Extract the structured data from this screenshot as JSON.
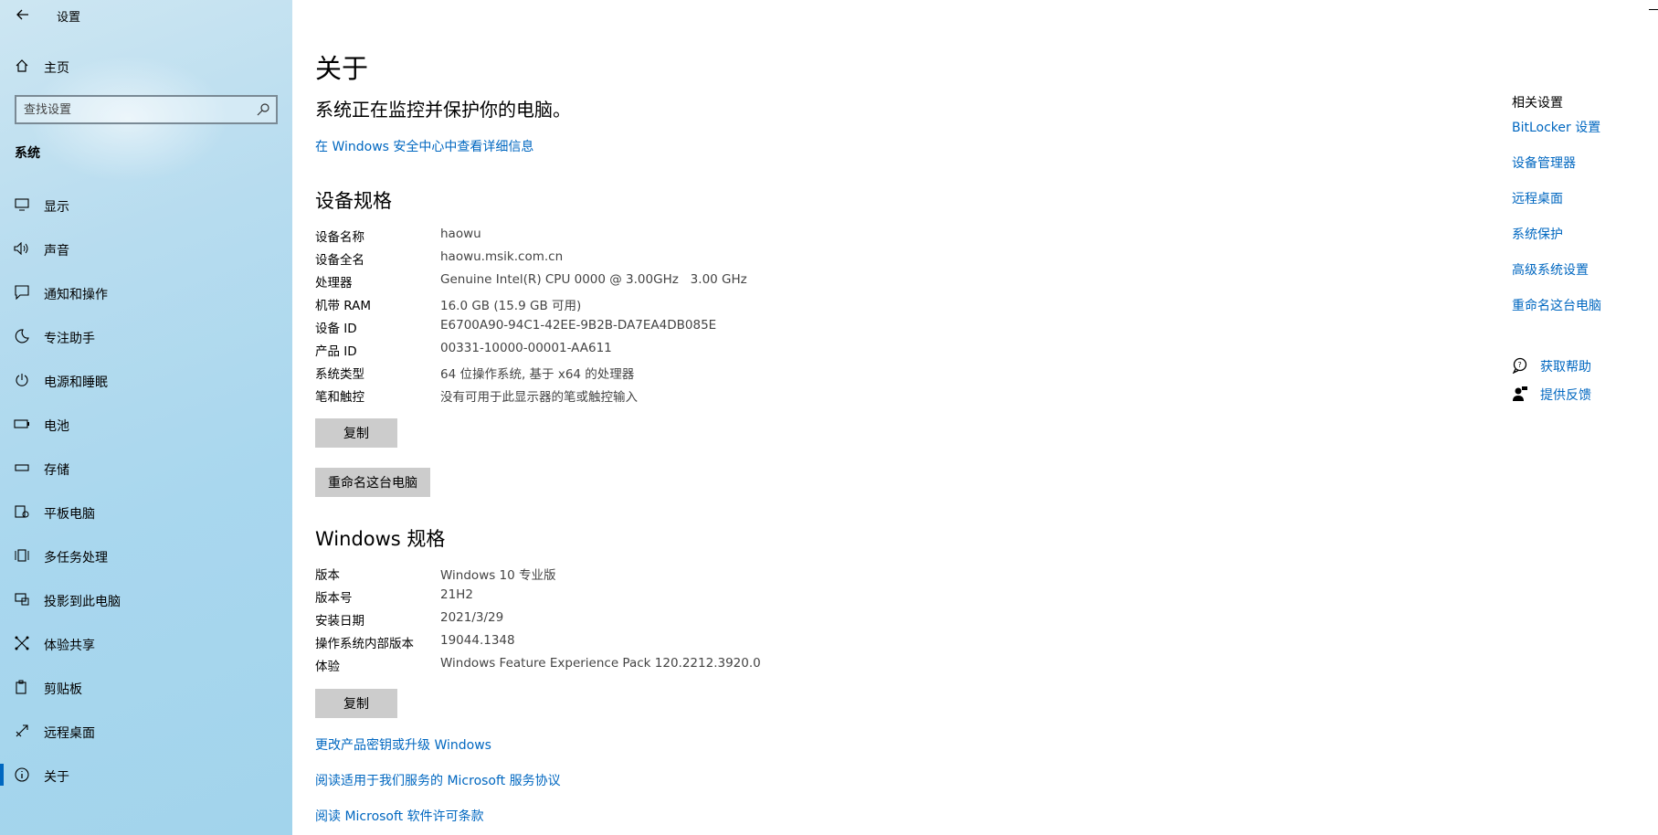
{
  "app": {
    "title": "设置",
    "back_icon": "back-arrow-icon"
  },
  "sidebar": {
    "home_label": "主页",
    "search_placeholder": "查找设置",
    "group_label": "系统",
    "items": [
      {
        "label": "显示",
        "icon": "display-icon"
      },
      {
        "label": "声音",
        "icon": "sound-icon"
      },
      {
        "label": "通知和操作",
        "icon": "notification-icon"
      },
      {
        "label": "专注助手",
        "icon": "moon-icon"
      },
      {
        "label": "电源和睡眠",
        "icon": "power-icon"
      },
      {
        "label": "电池",
        "icon": "battery-icon"
      },
      {
        "label": "存储",
        "icon": "storage-icon"
      },
      {
        "label": "平板电脑",
        "icon": "tablet-icon"
      },
      {
        "label": "多任务处理",
        "icon": "multitask-icon"
      },
      {
        "label": "投影到此电脑",
        "icon": "project-icon"
      },
      {
        "label": "体验共享",
        "icon": "share-icon"
      },
      {
        "label": "剪贴板",
        "icon": "clipboard-icon"
      },
      {
        "label": "远程桌面",
        "icon": "remote-icon"
      },
      {
        "label": "关于",
        "icon": "info-icon"
      }
    ]
  },
  "main": {
    "title": "关于",
    "protect_text": "系统正在监控并保护你的电脑。",
    "security_link": "在 Windows 安全中心中查看详细信息",
    "device_spec_title": "设备规格",
    "device_specs": [
      {
        "key": "设备名称",
        "value": "haowu"
      },
      {
        "key": "设备全名",
        "value": "haowu.msik.com.cn"
      },
      {
        "key": "处理器",
        "value": "Genuine Intel(R) CPU 0000 @ 3.00GHz   3.00 GHz"
      },
      {
        "key": "机带 RAM",
        "value": "16.0 GB (15.9 GB 可用)"
      },
      {
        "key": "设备 ID",
        "value": "E6700A90-94C1-42EE-9B2B-DA7EA4DB085E"
      },
      {
        "key": "产品 ID",
        "value": "00331-10000-00001-AA611"
      },
      {
        "key": "系统类型",
        "value": "64 位操作系统, 基于 x64 的处理器"
      },
      {
        "key": "笔和触控",
        "value": "没有可用于此显示器的笔或触控输入"
      }
    ],
    "copy_label": "复制",
    "rename_label": "重命名这台电脑",
    "windows_spec_title": "Windows 规格",
    "windows_specs": [
      {
        "key": "版本",
        "value": "Windows 10 专业版"
      },
      {
        "key": "版本号",
        "value": "21H2"
      },
      {
        "key": "安装日期",
        "value": "2021/3/29"
      },
      {
        "key": "操作系统内部版本",
        "value": "19044.1348"
      },
      {
        "key": "体验",
        "value": "Windows Feature Experience Pack 120.2212.3920.0"
      }
    ],
    "copy_label2": "复制",
    "bottom_links": [
      "更改产品密钥或升级 Windows",
      "阅读适用于我们服务的 Microsoft 服务协议",
      "阅读 Microsoft 软件许可条款"
    ]
  },
  "related": {
    "title": "相关设置",
    "links": [
      "BitLocker 设置",
      "设备管理器",
      "远程桌面",
      "系统保护",
      "高级系统设置",
      "重命名这台电脑"
    ],
    "help_label": "获取帮助",
    "feedback_label": "提供反馈"
  },
  "colors": {
    "accent": "#0067c0",
    "sidebar": "#a9d7ee",
    "button": "#cccccc"
  }
}
